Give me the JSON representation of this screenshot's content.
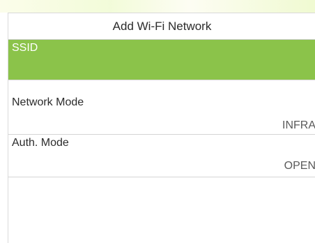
{
  "screen": {
    "title": "Add Wi-Fi Network"
  },
  "fields": [
    {
      "label": "SSID",
      "value": ""
    },
    {
      "label": "Network Mode",
      "value": "INFRA"
    },
    {
      "label": "Auth. Mode",
      "value": "OPEN"
    }
  ],
  "colors": {
    "selected_row": "#8bc34a",
    "divider": "#d4d4d4",
    "text": "#2b2b2b"
  }
}
